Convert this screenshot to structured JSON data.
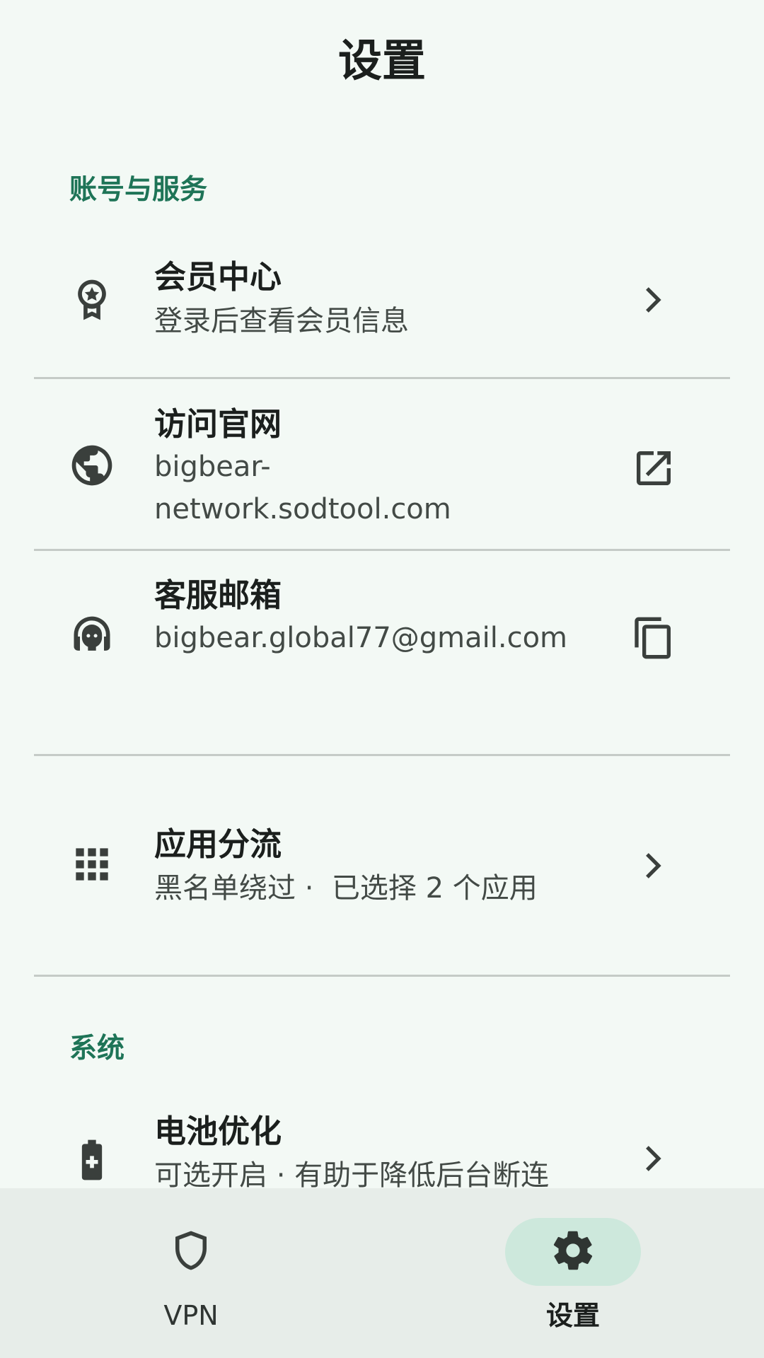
{
  "header": {
    "title": "设置"
  },
  "sections": {
    "account": {
      "label": "账号与服务"
    },
    "system": {
      "label": "系统"
    }
  },
  "rows": {
    "membership": {
      "title": "会员中心",
      "subtitle": "登录后查看会员信息",
      "icon": "award-ribbon-icon",
      "trail": "chevron-right-icon"
    },
    "website": {
      "title": "访问官网",
      "subtitle": "bigbear-network.sodtool.com",
      "icon": "globe-icon",
      "trail": "open-in-new-icon"
    },
    "support": {
      "title": "客服邮箱",
      "subtitle": "bigbear.global77@gmail.com",
      "icon": "headset-icon",
      "trail": "copy-icon"
    },
    "split": {
      "title": "应用分流",
      "subtitle": "黑名单绕过 ·  已选择 2 个应用",
      "icon": "apps-grid-icon",
      "trail": "chevron-right-icon"
    },
    "battery": {
      "title": "电池优化",
      "subtitle": "可选开启 · 有助于降低后台断连",
      "icon": "battery-charging-icon",
      "trail": "chevron-right-icon"
    }
  },
  "bottom_nav": {
    "items": [
      {
        "label": "VPN",
        "icon": "shield-icon",
        "active": false
      },
      {
        "label": "设置",
        "icon": "gear-icon",
        "active": true
      }
    ]
  },
  "colors": {
    "accent": "#1e7457",
    "background": "#f3f9f5",
    "nav_background": "#e7ede9",
    "active_pill": "#cde8dc"
  }
}
